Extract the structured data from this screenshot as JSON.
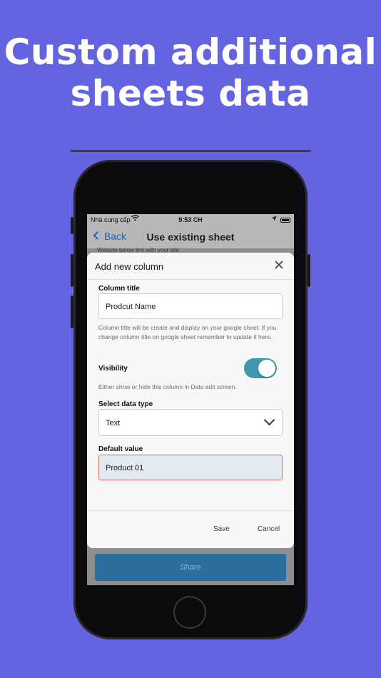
{
  "headline": {
    "line1": "Custom additional",
    "line2": "sheets data"
  },
  "status_bar": {
    "carrier": "Nhà cung cấp",
    "time": "9:53 CH"
  },
  "nav": {
    "back_label": "Back",
    "title": "Use existing sheet"
  },
  "background_snippet": "Website below link with your site",
  "modal": {
    "title": "Add new column",
    "column_title": {
      "label": "Column title",
      "value": "Prodcut Name",
      "help": "Column title will be create and display on your google sheet. If you change column title on google sheet remember to update it here."
    },
    "visibility": {
      "label": "Visibility",
      "help": "Either show or hide this column in Data edit screen.",
      "enabled": true,
      "on_color": "#3f97ad"
    },
    "data_type": {
      "label": "Select data type",
      "value": "Text"
    },
    "default_value": {
      "label": "Default value",
      "value": "Product 01",
      "error_border_color": "#d66a6a"
    },
    "save_label": "Save",
    "cancel_label": "Cancel"
  },
  "share_label": "Share",
  "icons": {
    "back": "chevron-left-icon",
    "close": "close-icon",
    "dropdown": "chevron-down-icon",
    "wifi": "wifi-icon",
    "location": "location-arrow-icon",
    "battery": "battery-icon"
  },
  "colors": {
    "background": "#6464e0",
    "accent": "#1e5fc8",
    "share_button": "#2a6f9f"
  }
}
